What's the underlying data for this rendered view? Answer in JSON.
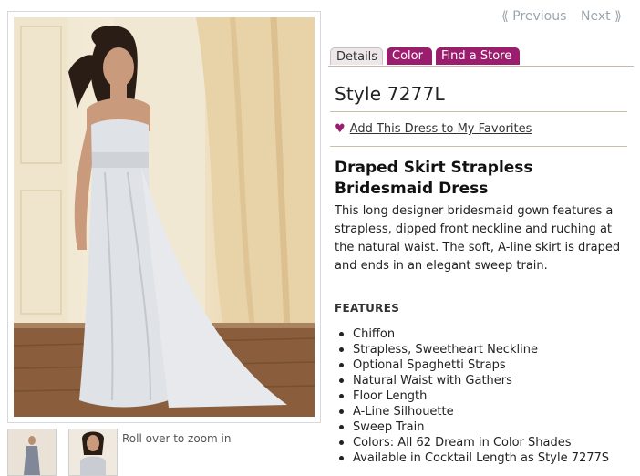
{
  "pager": {
    "previous_label": "Previous",
    "next_label": "Next"
  },
  "tabs": [
    {
      "label": "Details",
      "active": true
    },
    {
      "label": "Color",
      "active": false
    },
    {
      "label": "Find a Store",
      "active": false
    }
  ],
  "product": {
    "style_number": "Style 7277L",
    "favorite_link": "Add This Dress to My Favorites",
    "title": "Draped Skirt Strapless Bridesmaid Dress",
    "description": "This long designer bridesmaid gown features a strapless, dipped front neckline and ruching at the natural waist. The soft, A-line skirt is draped and ends in an elegant sweep train.",
    "features_heading": "FEATURES",
    "features": [
      "Chiffon",
      "Strapless, Sweetheart Neckline",
      "Optional Spaghetti Straps",
      "Natural Waist with Gathers",
      "Floor Length",
      "A-Line Silhouette",
      "Sweep Train",
      "Colors: All 62 Dream in Color Shades",
      "Available in Cocktail Length as Style 7277S"
    ]
  },
  "gallery": {
    "zoom_hint": "Roll over to zoom in"
  },
  "colors": {
    "accent": "#9b1e6e",
    "pager": "#9aa6ad",
    "rule": "#c9c0a8"
  }
}
